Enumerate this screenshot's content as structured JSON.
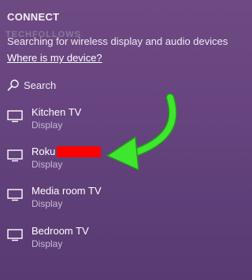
{
  "header": {
    "title": "CONNECT",
    "watermark": "TECHFOLLOWS",
    "status": "Searching for wireless display and audio devices",
    "help_link": "Where is my device?"
  },
  "search": {
    "label": "Search",
    "icon": "search-icon"
  },
  "devices": [
    {
      "name": "Kitchen TV",
      "kind": "Display",
      "icon": "tv-icon"
    },
    {
      "name": "Roku",
      "kind": "Display",
      "icon": "tv-icon",
      "redacted": true
    },
    {
      "name": "Media room TV",
      "kind": "Display",
      "icon": "tv-icon"
    },
    {
      "name": "Bedroom TV",
      "kind": "Display",
      "icon": "tv-icon"
    }
  ],
  "colors": {
    "background": "#684580",
    "secondary_text": "#c8b8d3",
    "arrow": "#3ee62e",
    "redaction": "#ff0000"
  }
}
